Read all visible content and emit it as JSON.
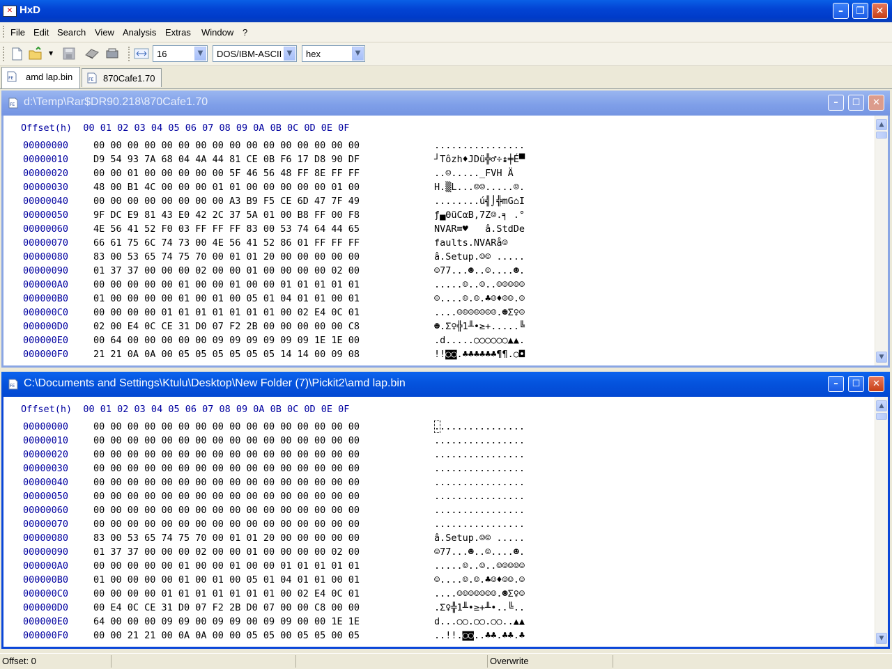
{
  "app": {
    "title": "HxD"
  },
  "menu": [
    "File",
    "Edit",
    "Search",
    "View",
    "Analysis",
    "Extras",
    "Window",
    "?"
  ],
  "toolbar": {
    "bytes_per_row": "16",
    "charset": "DOS/IBM-ASCII",
    "offset_base": "hex"
  },
  "tabs": [
    {
      "label": "amd lap.bin",
      "active": true
    },
    {
      "label": "870Cafe1.70",
      "active": false
    }
  ],
  "editors": [
    {
      "title": "d:\\Temp\\Rar$DR90.218\\870Cafe1.70",
      "active": false,
      "header": "Offset(h)  00 01 02 03 04 05 06 07 08 09 0A 0B 0C 0D 0E 0F",
      "rows": [
        {
          "off": "00000000",
          "hex": "00 00 00 00 00 00 00 00 00 00 00 00 00 00 00 00",
          "text": "................"
        },
        {
          "off": "00000010",
          "hex": "D9 54 93 7A 68 04 4A 44 81 CE 0B F6 17 D8 90 DF",
          "text": "┘Tôzh♦JDü╬♂÷↨╪É▀"
        },
        {
          "off": "00000020",
          "hex": "00 00 01 00 00 00 00 00 5F 46 56 48 FF 8E FF FF",
          "text": "..☺....._FVH Ä  "
        },
        {
          "off": "00000030",
          "hex": "48 00 B1 4C 00 00 00 01 01 00 00 00 00 00 01 00",
          "text": "H.▒L...☺☺.....☺."
        },
        {
          "off": "00000040",
          "hex": "00 00 00 00 00 00 00 00 A3 B9 F5 CE 6D 47 7F 49",
          "text": "........ú╣⌡╬mG⌂I"
        },
        {
          "off": "00000050",
          "hex": "9F DC E9 81 43 E0 42 2C 37 5A 01 00 B8 FF 00 F8",
          "text": "ƒ▄ΘüCαB,7Z☺.╕ .°"
        },
        {
          "off": "00000060",
          "hex": "4E 56 41 52 F0 03 FF FF FF 83 00 53 74 64 44 65",
          "text": "NVAR≡♥   â.StdDe"
        },
        {
          "off": "00000070",
          "hex": "66 61 75 6C 74 73 00 4E 56 41 52 86 01 FF FF FF",
          "text": "faults.NVARå☺   "
        },
        {
          "off": "00000080",
          "hex": "83 00 53 65 74 75 70 00 01 01 20 00 00 00 00 00",
          "text": "â.Setup.☺☺ ....."
        },
        {
          "off": "00000090",
          "hex": "01 37 37 00 00 00 02 00 00 01 00 00 00 00 02 00",
          "text": "☺77...☻..☺....☻."
        },
        {
          "off": "000000A0",
          "hex": "00 00 00 00 00 01 00 00 01 00 00 01 01 01 01 01",
          "text": ".....☺..☺..☺☺☺☺☺"
        },
        {
          "off": "000000B0",
          "hex": "01 00 00 00 00 01 00 01 00 05 01 04 01 01 00 01",
          "text": "☺....☺.☺.♣☺♦☺☺.☺"
        },
        {
          "off": "000000C0",
          "hex": "00 00 00 00 01 01 01 01 01 01 01 00 02 E4 0C 01",
          "text": "....☺☺☺☺☺☺☺.☻Σ♀☺"
        },
        {
          "off": "000000D0",
          "hex": "02 00 E4 0C CE 31 D0 07 F2 2B 00 00 00 00 00 C8",
          "text": "☻.Σ♀╬1╨•≥+.....╚"
        },
        {
          "off": "000000E0",
          "hex": "00 64 00 00 00 00 00 09 09 09 09 09 09 1E 1E 00",
          "text": ".d.....○○○○○○▲▲."
        },
        {
          "off": "000000F0",
          "hex": "21 21 0A 0A 00 05 05 05 05 05 05 14 14 00 09 08",
          "text": "!!◙◙.♣♣♣♣♣♣¶¶.○◘"
        }
      ]
    },
    {
      "title": "C:\\Documents and Settings\\Ktulu\\Desktop\\New Folder (7)\\Pickit2\\amd lap.bin",
      "active": true,
      "header": "Offset(h)  00 01 02 03 04 05 06 07 08 09 0A 0B 0C 0D 0E 0F",
      "rows": [
        {
          "off": "00000000",
          "hex": "00 00 00 00 00 00 00 00 00 00 00 00 00 00 00 00",
          "text": "................"
        },
        {
          "off": "00000010",
          "hex": "00 00 00 00 00 00 00 00 00 00 00 00 00 00 00 00",
          "text": "................"
        },
        {
          "off": "00000020",
          "hex": "00 00 00 00 00 00 00 00 00 00 00 00 00 00 00 00",
          "text": "................"
        },
        {
          "off": "00000030",
          "hex": "00 00 00 00 00 00 00 00 00 00 00 00 00 00 00 00",
          "text": "................"
        },
        {
          "off": "00000040",
          "hex": "00 00 00 00 00 00 00 00 00 00 00 00 00 00 00 00",
          "text": "................"
        },
        {
          "off": "00000050",
          "hex": "00 00 00 00 00 00 00 00 00 00 00 00 00 00 00 00",
          "text": "................"
        },
        {
          "off": "00000060",
          "hex": "00 00 00 00 00 00 00 00 00 00 00 00 00 00 00 00",
          "text": "................"
        },
        {
          "off": "00000070",
          "hex": "00 00 00 00 00 00 00 00 00 00 00 00 00 00 00 00",
          "text": "................"
        },
        {
          "off": "00000080",
          "hex": "83 00 53 65 74 75 70 00 01 01 20 00 00 00 00 00",
          "text": "â.Setup.☺☺ ....."
        },
        {
          "off": "00000090",
          "hex": "01 37 37 00 00 00 02 00 00 01 00 00 00 00 02 00",
          "text": "☺77...☻..☺....☻."
        },
        {
          "off": "000000A0",
          "hex": "00 00 00 00 00 01 00 00 01 00 00 01 01 01 01 01",
          "text": ".....☺..☺..☺☺☺☺☺"
        },
        {
          "off": "000000B0",
          "hex": "01 00 00 00 00 01 00 01 00 05 01 04 01 01 00 01",
          "text": "☺....☺.☺.♣☺♦☺☺.☺"
        },
        {
          "off": "000000C0",
          "hex": "00 00 00 00 01 01 01 01 01 01 01 00 02 E4 0C 01",
          "text": "....☺☺☺☺☺☺☺.☻Σ♀☺"
        },
        {
          "off": "000000D0",
          "hex": "00 E4 0C CE 31 D0 07 F2 2B D0 07 00 00 C8 00 00",
          "text": ".Σ♀╬1╨•≥+╨•..╚.."
        },
        {
          "off": "000000E0",
          "hex": "64 00 00 00 09 09 00 09 09 00 09 09 00 00 1E 1E",
          "text": "d...○○.○○.○○..▲▲"
        },
        {
          "off": "000000F0",
          "hex": "00 00 21 21 00 0A 0A 00 00 05 05 00 05 05 00 05",
          "text": "..!!.◙◙..♣♣.♣♣.♣"
        }
      ]
    }
  ],
  "status": {
    "offset": "Offset: 0",
    "mode": "Overwrite"
  }
}
